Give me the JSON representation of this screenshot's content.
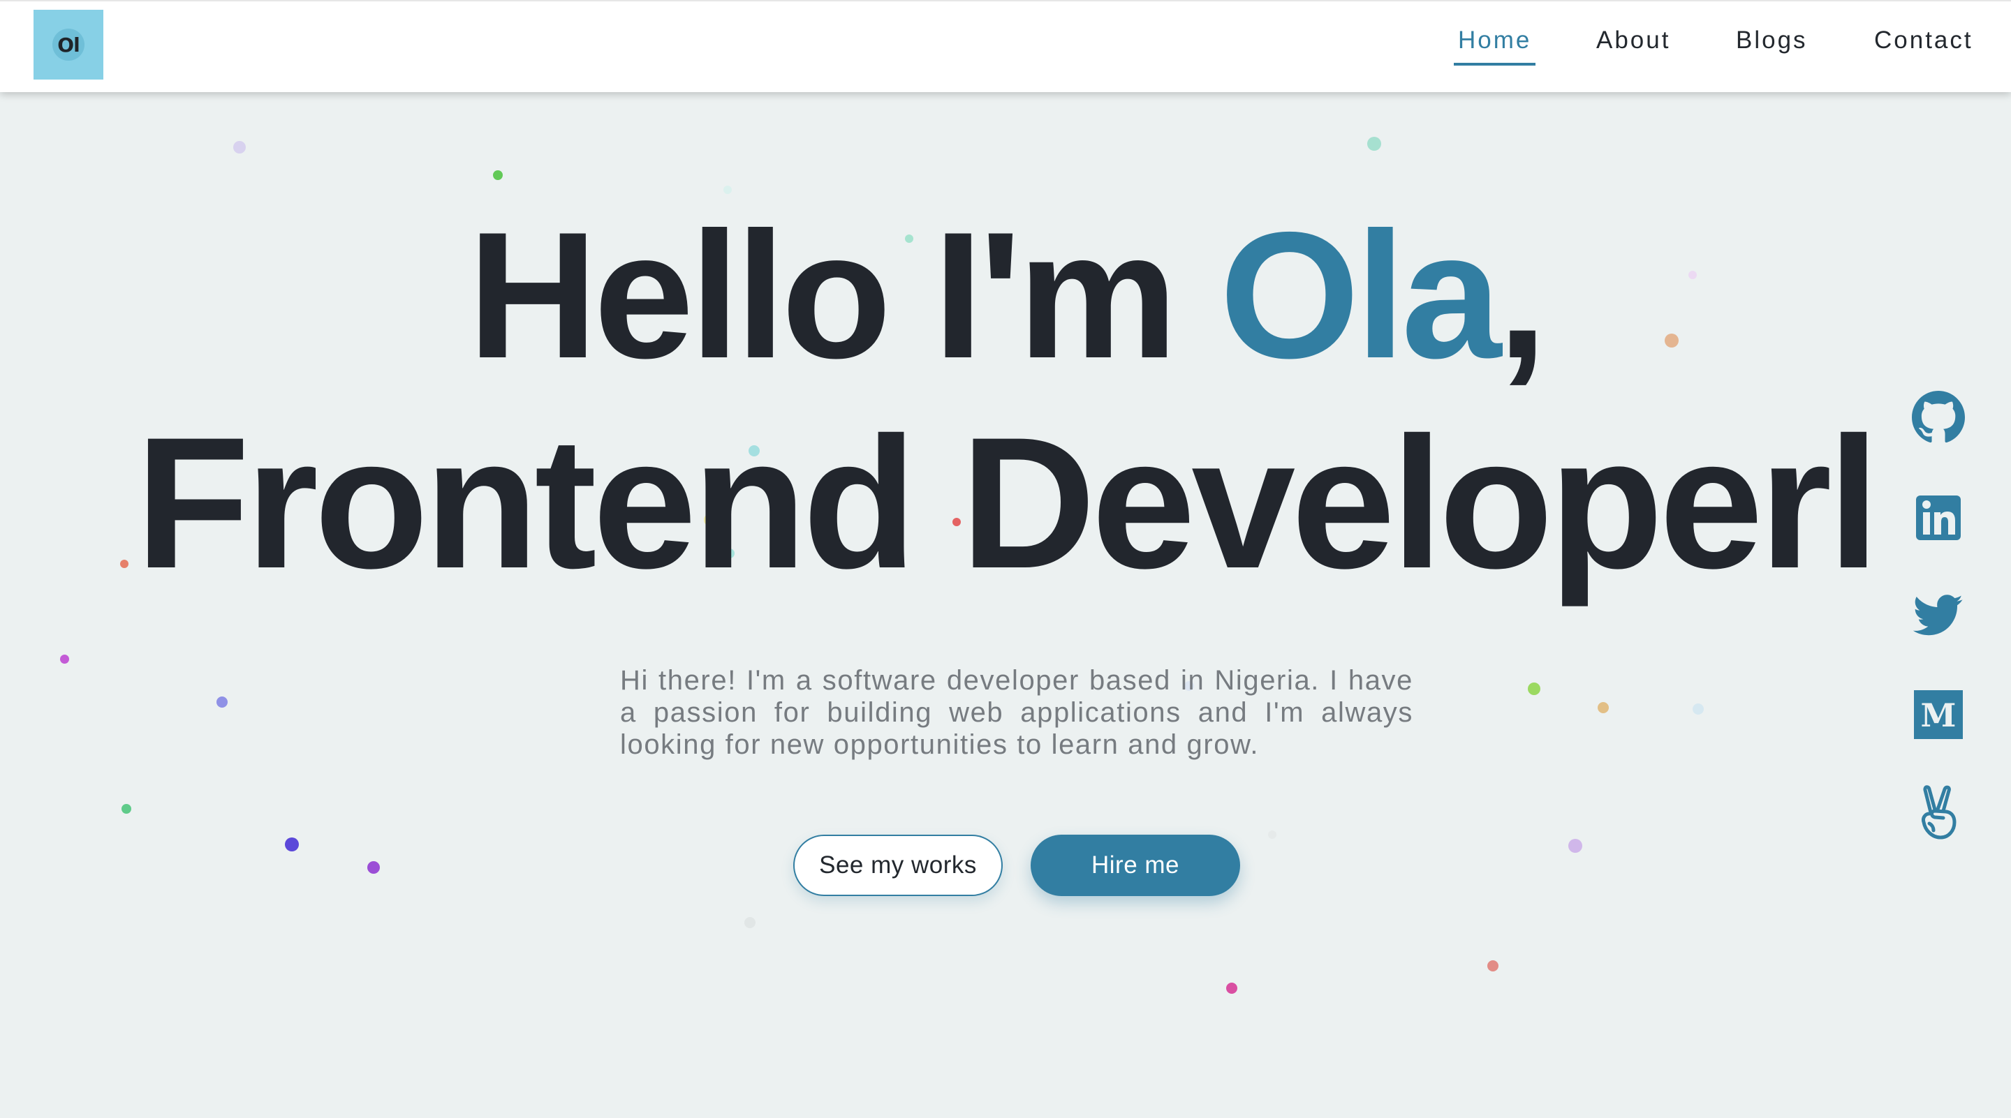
{
  "header": {
    "logo_text": "Ol",
    "nav": [
      {
        "label": "Home",
        "active": true
      },
      {
        "label": "About",
        "active": false
      },
      {
        "label": "Blogs",
        "active": false
      },
      {
        "label": "Contact",
        "active": false
      }
    ]
  },
  "hero": {
    "line1_prefix": "Hello I'm ",
    "name": "Ola",
    "line1_suffix": ",",
    "line2": "Frontend Developerl",
    "intro": "Hi there! I'm a software developer based in Nigeria. I have a passion for building web applications and I'm always looking for new opportunities to learn and grow."
  },
  "buttons": {
    "works_label": "See my works",
    "hire_label": "Hire me"
  },
  "social": [
    {
      "icon": "github-icon"
    },
    {
      "icon": "linkedin-icon"
    },
    {
      "icon": "twitter-icon"
    },
    {
      "icon": "medium-icon"
    },
    {
      "icon": "angellist-icon"
    }
  ],
  "colors": {
    "accent": "#327ea2",
    "background": "#ecf1f1",
    "heading": "#22262d",
    "body_text": "#767b80",
    "logo_bg": "#87d0e6"
  }
}
